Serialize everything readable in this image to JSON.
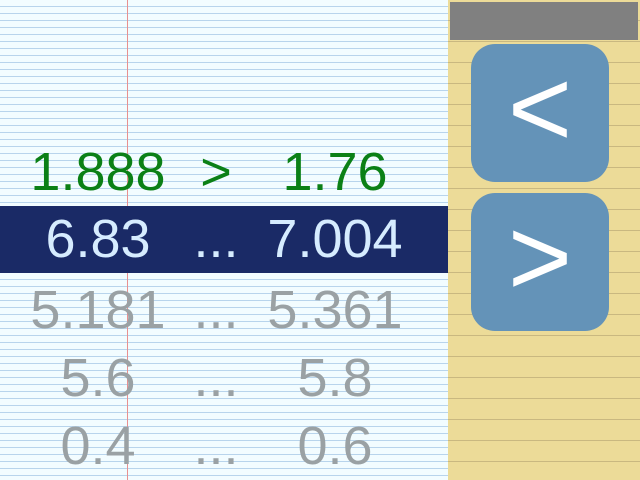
{
  "rows": {
    "answered": {
      "left": "1.888",
      "op": ">",
      "right": "1.76"
    },
    "current": {
      "left": "6.83",
      "op": "...",
      "right": "7.004"
    },
    "upcoming": [
      {
        "left": "5.181",
        "op": "...",
        "right": "5.361"
      },
      {
        "left": "5.6",
        "op": "...",
        "right": "5.8"
      },
      {
        "left": "0.4",
        "op": "...",
        "right": "0.6"
      }
    ]
  },
  "buttons": {
    "less_label": "<",
    "greater_label": ">"
  },
  "colors": {
    "answered_text": "#0b8016",
    "current_bg": "#1a2a66",
    "current_text": "#d6ecff",
    "upcoming_text": "#9aa1a4",
    "button_bg": "#6493b8",
    "panel_bg": "#ecdb98"
  }
}
